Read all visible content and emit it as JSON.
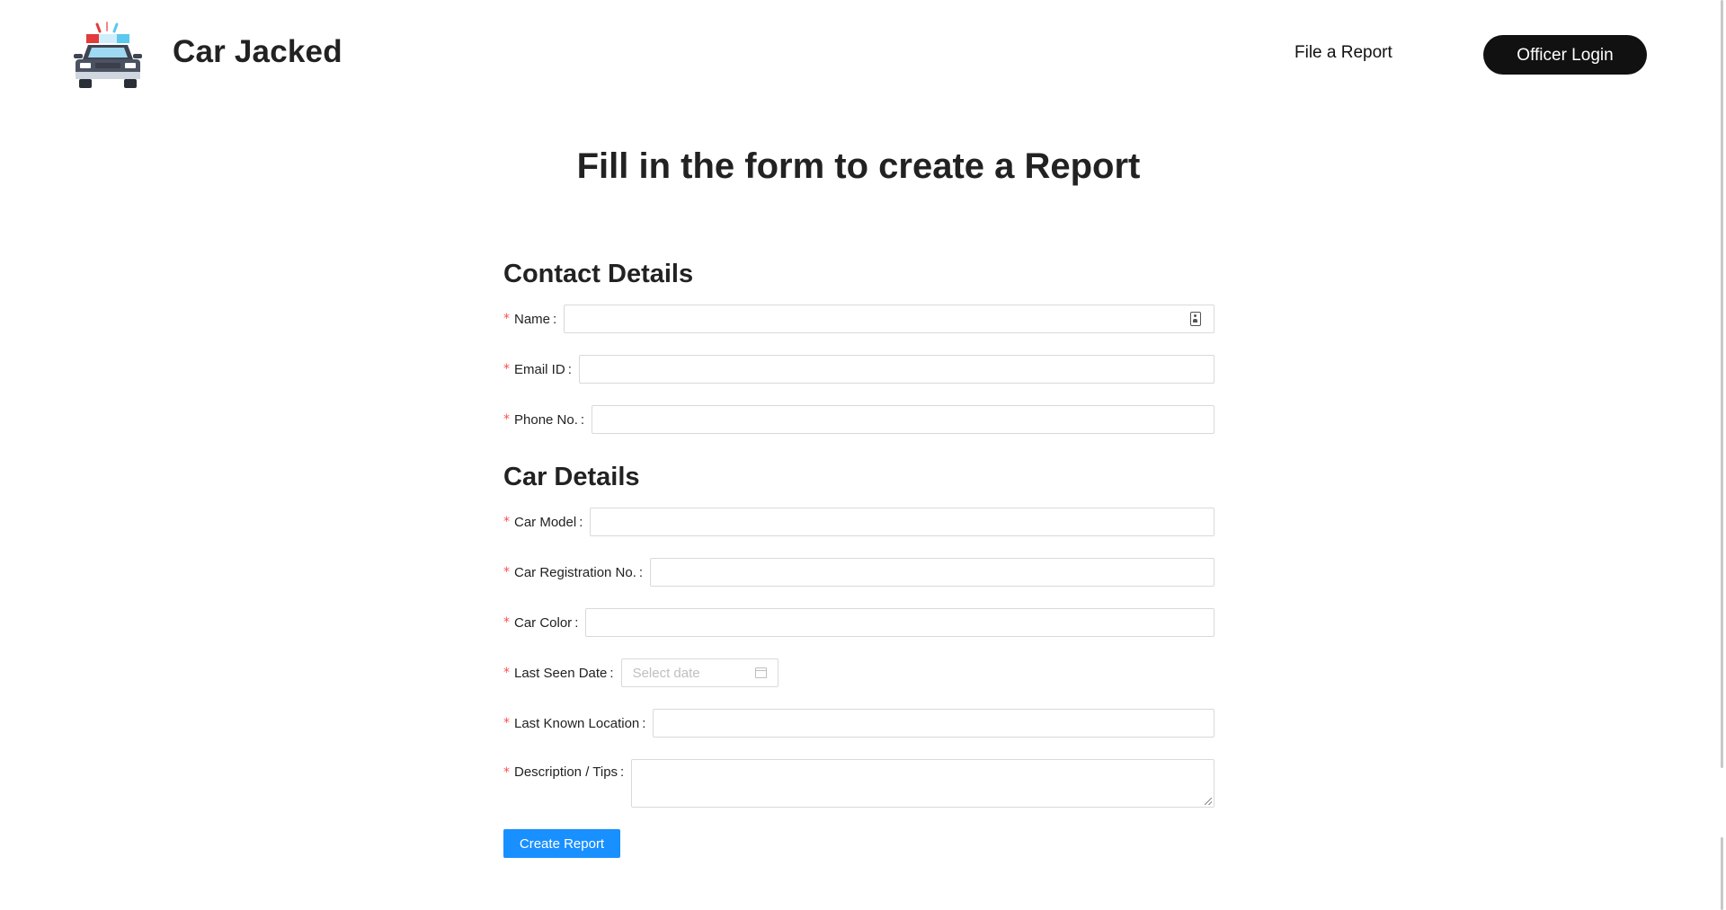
{
  "header": {
    "brand": "Car Jacked",
    "logo_icon": "police-car-icon",
    "nav": {
      "file_report": "File a Report",
      "officer_login": "Officer Login"
    }
  },
  "main": {
    "title": "Fill in the form to create a Report",
    "required_mark": "*",
    "contact_section": {
      "title": "Contact Details",
      "fields": {
        "name": {
          "label": "Name",
          "value": ""
        },
        "email": {
          "label": "Email ID",
          "value": ""
        },
        "phone": {
          "label": "Phone No.",
          "value": ""
        }
      }
    },
    "car_section": {
      "title": "Car Details",
      "fields": {
        "model": {
          "label": "Car Model",
          "value": ""
        },
        "registration": {
          "label": "Car Registration No.",
          "value": ""
        },
        "color": {
          "label": "Car Color",
          "value": ""
        },
        "last_seen_date": {
          "label": "Last Seen Date",
          "placeholder": "Select date"
        },
        "last_location": {
          "label": "Last Known Location",
          "value": ""
        },
        "description": {
          "label": "Description / Tips",
          "value": ""
        }
      }
    },
    "submit_label": "Create Report"
  },
  "colors": {
    "primary_button": "#1890ff",
    "login_button": "#111111",
    "required_star": "#ff4d4f",
    "input_border": "#d9d9d9"
  }
}
